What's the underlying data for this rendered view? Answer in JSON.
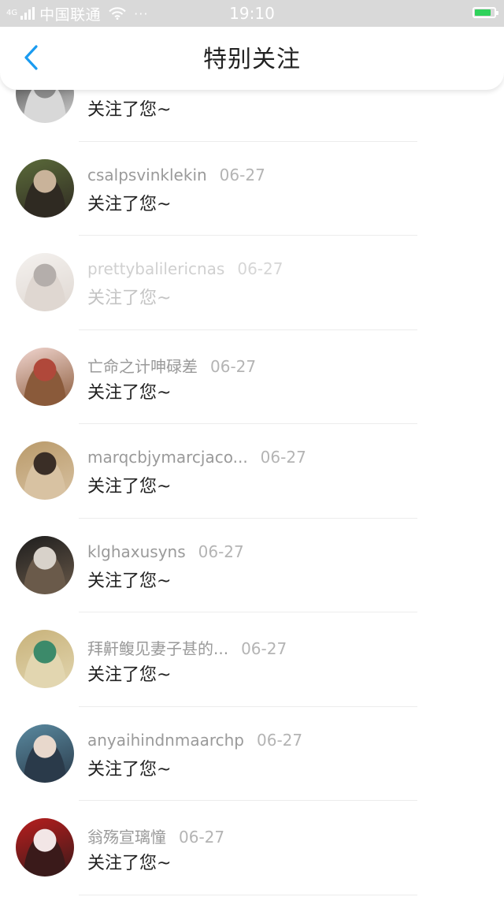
{
  "status_bar": {
    "sim_label": "4G",
    "carrier": "中国联通",
    "more": "···",
    "time": "19:10",
    "battery_level": 0.85,
    "battery_color": "#2fd25b",
    "icons": [
      "signal-icon",
      "wifi-icon",
      "battery-icon"
    ]
  },
  "header": {
    "back_icon": "chevron-left-icon",
    "back_color": "#1a9bf0",
    "title": "特别关注"
  },
  "items": [
    {
      "name": "",
      "date": "",
      "message": "关注了您~",
      "faded": false,
      "avatar": "avatar-photo"
    },
    {
      "name": "csalpsvinklekin",
      "date": "06-27",
      "message": "关注了您~",
      "faded": false,
      "avatar": "avatar-photo"
    },
    {
      "name": "prettybalilericnas",
      "date": "06-27",
      "message": "关注了您~",
      "faded": true,
      "avatar": "avatar-photo"
    },
    {
      "name": "亡命之计呻碌差",
      "date": "06-27",
      "message": "关注了您~",
      "faded": false,
      "avatar": "avatar-photo"
    },
    {
      "name": "marqcbjymarcjaco...",
      "date": "06-27",
      "message": "关注了您~",
      "faded": false,
      "avatar": "avatar-photo"
    },
    {
      "name": "klghaxusyns",
      "date": "06-27",
      "message": "关注了您~",
      "faded": false,
      "avatar": "avatar-photo"
    },
    {
      "name": "拜鼾鳆见妻子甚的...",
      "date": "06-27",
      "message": "关注了您~",
      "faded": false,
      "avatar": "avatar-photo"
    },
    {
      "name": "anyaihindnmaarchp",
      "date": "06-27",
      "message": "关注了您~",
      "faded": false,
      "avatar": "avatar-photo"
    },
    {
      "name": "翁殇宣璃憧",
      "date": "06-27",
      "message": "关注了您~",
      "faded": false,
      "avatar": "avatar-photo"
    }
  ]
}
